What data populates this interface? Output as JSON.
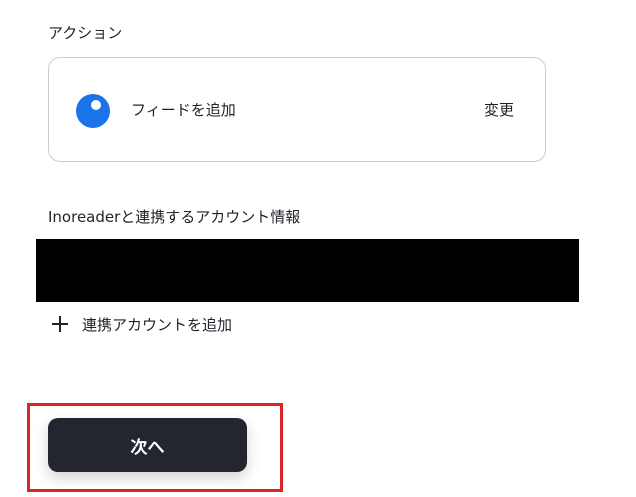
{
  "action_section": {
    "label": "アクション",
    "card": {
      "icon": "inoreader-icon",
      "action_name": "フィードを追加",
      "change_label": "変更"
    }
  },
  "account_section": {
    "label": "Inoreaderと連携するアカウント情報",
    "add_account_label": "連携アカウントを追加",
    "add_icon": "plus-icon"
  },
  "footer": {
    "next_label": "次へ",
    "highlight_color": "#d9252a",
    "button_color": "#23262e"
  }
}
